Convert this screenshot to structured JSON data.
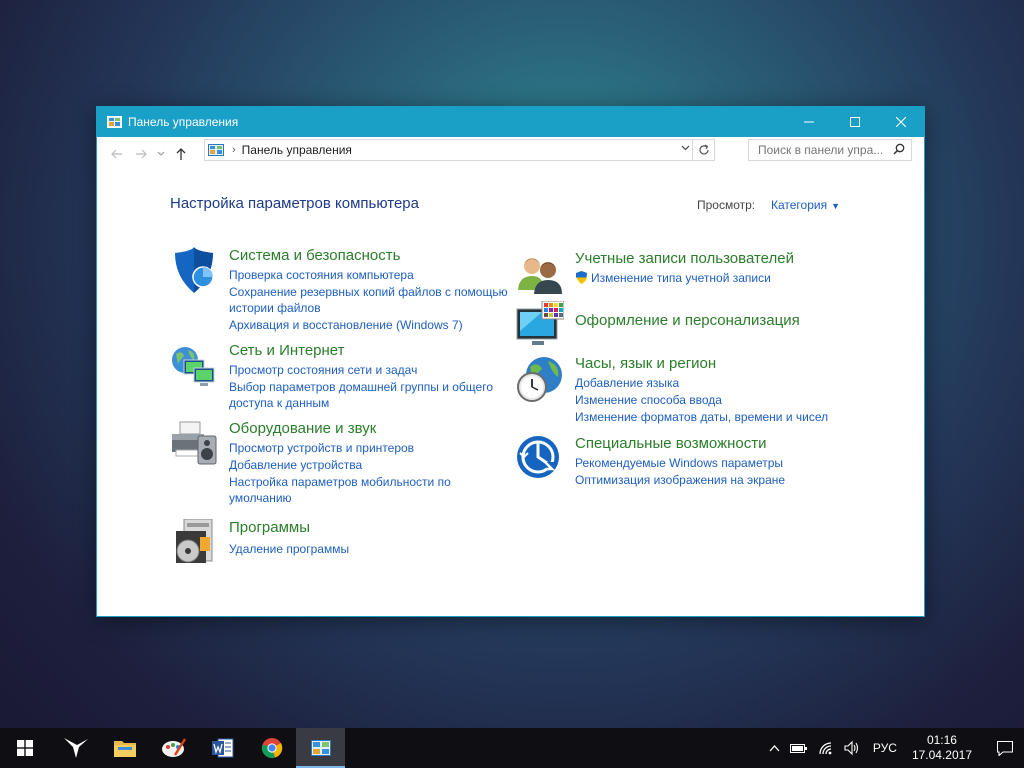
{
  "window": {
    "title": "Панель управления",
    "breadcrumb": "Панель управления",
    "search_placeholder": "Поиск в панели упра..."
  },
  "content": {
    "heading": "Настройка параметров компьютера",
    "view_label": "Просмотр:",
    "view_value": "Категория"
  },
  "categories": {
    "system": {
      "title": "Система и безопасность",
      "icon": "shield-icon",
      "links": [
        "Проверка состояния компьютера",
        "Сохранение резервных копий файлов с помощью истории файлов",
        "Архивация и восстановление (Windows 7)"
      ]
    },
    "network": {
      "title": "Сеть и Интернет",
      "icon": "network-globe-icon",
      "links": [
        "Просмотр состояния сети и задач",
        "Выбор параметров домашней группы и общего доступа к данным"
      ]
    },
    "hardware": {
      "title": "Оборудование и звук",
      "icon": "printer-speaker-icon",
      "links": [
        "Просмотр устройств и принтеров",
        "Добавление устройства",
        "Настройка параметров мобильности по умолчанию"
      ]
    },
    "programs": {
      "title": "Программы",
      "icon": "programs-disc-icon",
      "links": [
        "Удаление программы"
      ]
    },
    "accounts": {
      "title": "Учетные записи пользователей",
      "icon": "users-icon",
      "links": [
        "Изменение типа учетной записи"
      ]
    },
    "appearance": {
      "title": "Оформление и персонализация",
      "icon": "monitor-palette-icon",
      "links": []
    },
    "clock": {
      "title": "Часы, язык и регион",
      "icon": "clock-globe-icon",
      "links": [
        "Добавление языка",
        "Изменение способа ввода",
        "Изменение форматов даты, времени и чисел"
      ]
    },
    "access": {
      "title": "Специальные возможности",
      "icon": "ease-of-access-icon",
      "links": [
        "Рекомендуемые Windows параметры",
        "Оптимизация изображения на экране"
      ]
    }
  },
  "taskbar": {
    "apps": [
      "start-icon",
      "app-bird-icon",
      "file-explorer-icon",
      "paint-icon",
      "word-icon",
      "chrome-icon",
      "control-panel-icon"
    ],
    "language": "РУС",
    "time": "01:16",
    "date": "17.04.2017"
  },
  "colors": {
    "titlebar": "#1aa0c6",
    "category_title": "#2a7e2a",
    "link": "#1e5fbe",
    "heading": "#1e3a8a",
    "taskbar": "#0e0e13"
  }
}
